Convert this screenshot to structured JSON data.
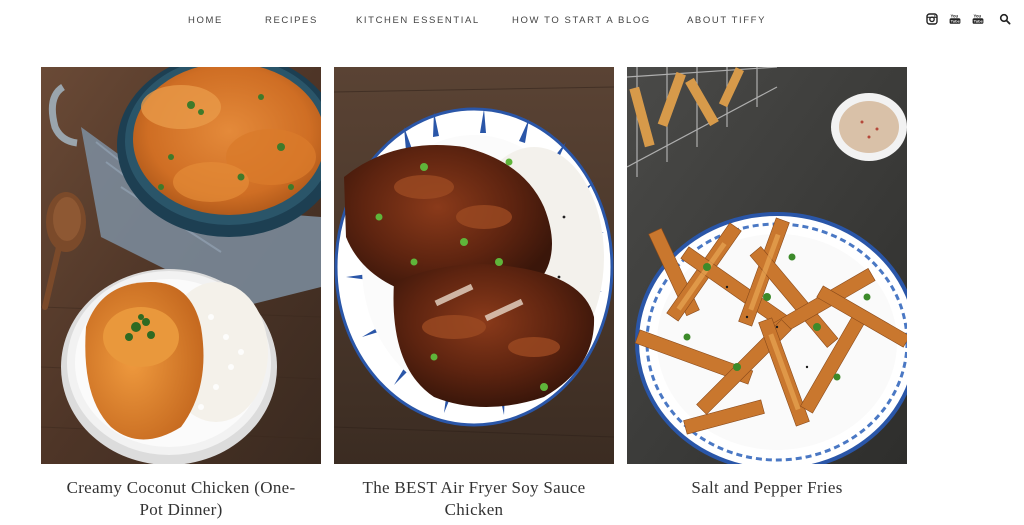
{
  "nav": {
    "items": [
      {
        "label": "HOME"
      },
      {
        "label": "RECIPES"
      },
      {
        "label": "KITCHEN ESSENTIAL"
      },
      {
        "label": "HOW TO START A BLOG"
      },
      {
        "label": "ABOUT TIFFY"
      }
    ],
    "icons": [
      "instagram-icon",
      "youtube-icon",
      "youtube-icon",
      "search-icon"
    ]
  },
  "cards": [
    {
      "title": "Creamy Coconut Chicken (One-Pot Dinner)"
    },
    {
      "title": "The BEST Air Fryer Soy Sauce Chicken"
    },
    {
      "title": "Salt and Pepper Fries"
    }
  ],
  "colors": {
    "nav_text": "#444444",
    "title_text": "#333333",
    "background": "#ffffff"
  }
}
